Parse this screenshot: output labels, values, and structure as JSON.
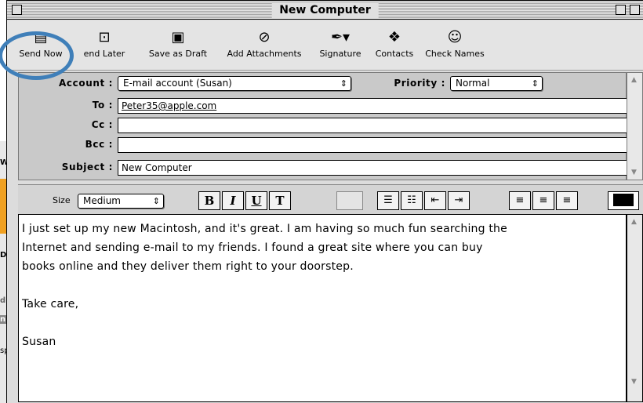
{
  "window": {
    "title": "New Computer"
  },
  "background_app": {
    "fragments": [
      "W",
      "Du",
      "d",
      "n",
      "sp"
    ]
  },
  "toolbar": {
    "items": [
      {
        "label": "Send Now",
        "icon": "send-now-icon"
      },
      {
        "label": "end Later",
        "icon": "send-later-icon"
      },
      {
        "label": "Save as Draft",
        "icon": "save-icon"
      },
      {
        "label": "Add Attachments",
        "icon": "paperclip-icon"
      },
      {
        "label": "Signature",
        "icon": "pen-icon"
      },
      {
        "label": "Contacts",
        "icon": "contacts-icon"
      },
      {
        "label": "Check Names",
        "icon": "check-names-icon"
      }
    ],
    "highlight_color": "#3f7fb9"
  },
  "header": {
    "account_label": "Account :",
    "account_value": "E-mail account (Susan)",
    "priority_label": "Priority :",
    "priority_value": "Normal",
    "to_label": "To :",
    "to_value": "Peter35@apple.com",
    "cc_label": "Cc :",
    "cc_value": "",
    "bcc_label": "Bcc :",
    "bcc_value": "",
    "subject_label": "Subject :",
    "subject_value": "New Computer"
  },
  "format": {
    "size_label": "Size",
    "size_value": "Medium",
    "bold": "B",
    "italic": "I",
    "underline": "U",
    "plain": "T"
  },
  "message": {
    "body": "I just set up my new Macintosh, and it's great. I am having so much fun searching the\nInternet and sending e-mail to my friends. I found a great site where you can buy\nbooks online and they deliver them right to your doorstep.\n\nTake care,\n\nSusan"
  }
}
